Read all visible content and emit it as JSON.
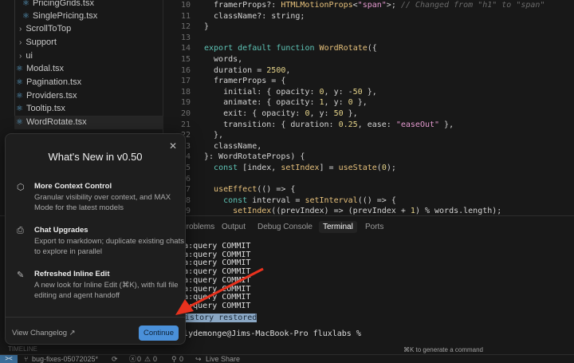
{
  "explorer": {
    "items": [
      {
        "label": "PricingGrids.tsx",
        "type": "file",
        "icon": "react-icon"
      },
      {
        "label": "SinglePricing.tsx",
        "type": "file",
        "icon": "react-icon"
      },
      {
        "label": "ScrollToTop",
        "type": "folder",
        "icon": "chevron-right-icon"
      },
      {
        "label": "Support",
        "type": "folder",
        "icon": "chevron-right-icon"
      },
      {
        "label": "ui",
        "type": "folder",
        "icon": "chevron-right-icon"
      },
      {
        "label": "Modal.tsx",
        "type": "file",
        "icon": "react-icon"
      },
      {
        "label": "Pagination.tsx",
        "type": "file",
        "icon": "react-icon"
      },
      {
        "label": "Providers.tsx",
        "type": "file",
        "icon": "react-icon"
      },
      {
        "label": "Tooltip.tsx",
        "type": "file",
        "icon": "react-icon"
      },
      {
        "label": "WordRotate.tsx",
        "type": "file",
        "icon": "react-icon",
        "selected": true
      }
    ],
    "timeline": "TIMELINE"
  },
  "editor": {
    "line_numbers": [
      "10",
      "11",
      "12",
      "13",
      "14",
      "15",
      "16",
      "17",
      "18",
      "19",
      "20",
      "21",
      "22",
      "23",
      "24",
      "25",
      "26",
      "27",
      "28",
      "29"
    ],
    "lines": [
      "  framerProps?: HTMLMotionProps<\"span\">; // Changed from \"h1\" to \"span\"",
      "  className?: string;",
      "}",
      "",
      "export default function WordRotate({",
      "  words,",
      "  duration = 2500,",
      "  framerProps = {",
      "    initial: { opacity: 0, y: -50 },",
      "    animate: { opacity: 1, y: 0 },",
      "    exit: { opacity: 0, y: 50 },",
      "    transition: { duration: 0.25, ease: \"easeOut\" },",
      "  },",
      "  className,",
      "}: WordRotateProps) {",
      "  const [index, setIndex] = useState(0);",
      "",
      "  useEffect(() => {",
      "    const interval = setInterval(() => {",
      "      setIndex((prevIndex) => (prevIndex + 1) % words.length);"
    ]
  },
  "panel": {
    "tabs": [
      "Problems",
      "Output",
      "Debug Console",
      "Terminal",
      "Ports"
    ],
    "active_tab": "Terminal",
    "terminal": {
      "lines": [
        "prisma:query COMMIT",
        "prisma:query COMMIT",
        "prisma:query COMMIT",
        "prisma:query COMMIT",
        "prisma:query COMMIT",
        "prisma:query COMMIT",
        "prisma:query COMMIT",
        "prisma:query COMMIT"
      ],
      "history": "History restored",
      "prompt": "jimmclydemonge@Jims-MacBook-Pro fluxlabs %"
    },
    "hint": "⌘K to generate a command"
  },
  "modal": {
    "title": "What's New in v0.50",
    "features": [
      {
        "icon": "cube-icon",
        "title": "More Context Control",
        "desc": "Granular visibility over context, and MAX Mode for the latest models"
      },
      {
        "icon": "export-icon",
        "title": "Chat Upgrades",
        "desc": "Export to markdown; duplicate existing chats to explore in parallel"
      },
      {
        "icon": "edit-chat-icon",
        "title": "Refreshed Inline Edit",
        "desc": "A new look for Inline Edit (⌘K), with full file editing and agent handoff"
      }
    ],
    "changelog": "View Changelog ↗",
    "continue": "Continue"
  },
  "status": {
    "branch": "bug-fixes-05072025*",
    "errors": "0",
    "warnings": "0",
    "ports": "0",
    "live_share": "Live Share"
  },
  "colors": {
    "accent": "#4a90d9",
    "annotation_arrow": "#e8321e"
  }
}
